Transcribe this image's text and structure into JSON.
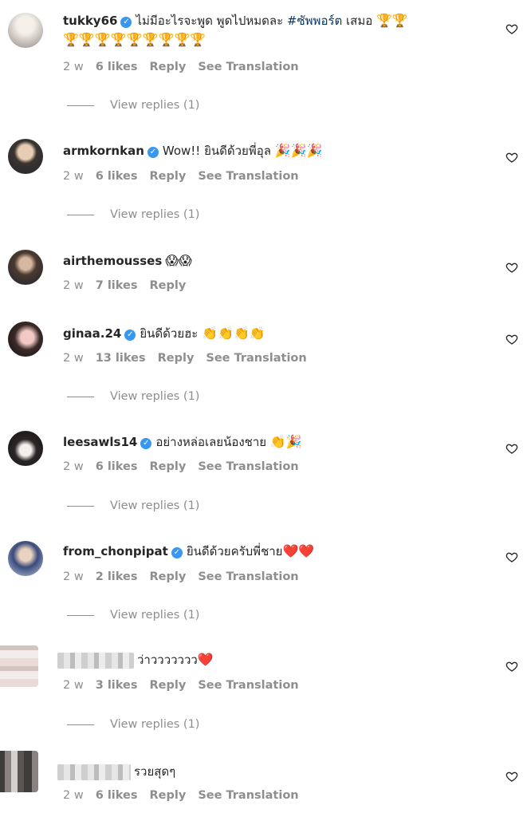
{
  "comments": [
    {
      "username": "tukky66",
      "verified": true,
      "text_pre": "ไม่มีอะไรจะพูด พูดไปหมดละ ",
      "hashtag": "#ซัพพอร์ต",
      "text_post": " เสมอ ",
      "emoji": "🏆🏆",
      "emoji_line2": "🏆🏆🏆🏆🏆🏆🏆🏆🏆",
      "time": "2 w",
      "likes": "6 likes",
      "reply": "Reply",
      "translate": "See Translation",
      "view_replies": "View replies (1)"
    },
    {
      "username": "armkornkan",
      "verified": true,
      "text": "Wow!! ยินดีด้วยพี่อุล ",
      "emoji": "🎉🎉🎉",
      "time": "2 w",
      "likes": "6 likes",
      "reply": "Reply",
      "translate": "See Translation",
      "view_replies": "View replies (1)"
    },
    {
      "username": "airthemousses",
      "verified": false,
      "text": "",
      "emoji": "😱😱",
      "time": "2 w",
      "likes": "7 likes",
      "reply": "Reply"
    },
    {
      "username": "ginaa.24",
      "verified": true,
      "text": "ยินดีด้วยฮะ ",
      "emoji": "👏👏👏👏",
      "time": "2 w",
      "likes": "13 likes",
      "reply": "Reply",
      "translate": "See Translation",
      "view_replies": "View replies (1)"
    },
    {
      "username": "leesawls14",
      "verified": true,
      "text": "อย่างหล่อเลยน้องชาย ",
      "emoji": "👏🎉",
      "time": "2 w",
      "likes": "6 likes",
      "reply": "Reply",
      "translate": "See Translation",
      "view_replies": "View replies (1)"
    },
    {
      "username": "from_chonpipat",
      "verified": true,
      "text": "ยินดีด้วยครับพี่ชาย",
      "emoji": "❤️❤️",
      "time": "2 w",
      "likes": "2 likes",
      "reply": "Reply",
      "translate": "See Translation",
      "view_replies": "View replies (1)"
    },
    {
      "username": "",
      "verified": false,
      "text": "ว่าววววววว",
      "emoji": "❤️",
      "time": "2 w",
      "likes": "3 likes",
      "reply": "Reply",
      "translate": "See Translation",
      "view_replies": "View replies (1)"
    },
    {
      "username": "",
      "verified": false,
      "text": "รวยสุดๆ",
      "emoji": "",
      "time": "2 w",
      "likes": "6 likes",
      "reply": "Reply",
      "translate": "See Translation"
    }
  ],
  "icons": {
    "like": "heart-outline-icon",
    "verified": "verified-badge-icon"
  },
  "colors": {
    "verified": "#3897f0",
    "meta": "#8e8e8e",
    "hashtag": "#00376b"
  }
}
